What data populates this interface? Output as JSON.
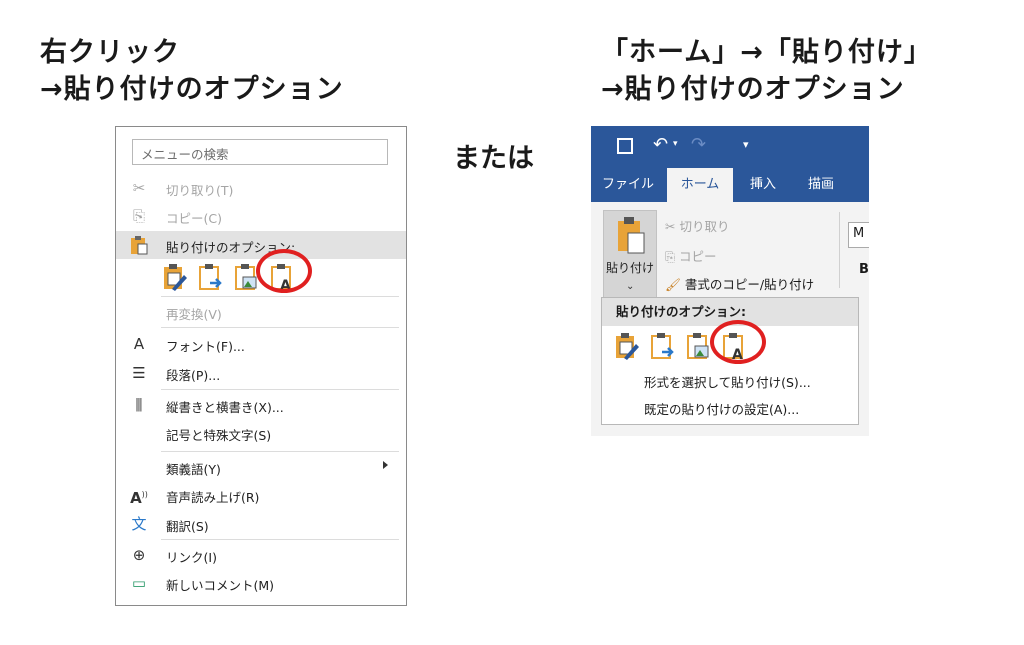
{
  "headings": {
    "left_line1": "右クリック",
    "left_line2": "→貼り付けのオプション",
    "right_line1": "「ホーム」→「貼り付け」",
    "right_line2": "→貼り付けのオプション",
    "or": "または"
  },
  "context_menu": {
    "search_placeholder": "メニューの検索",
    "cut": "切り取り(T)",
    "copy": "コピー(C)",
    "paste_options": "貼り付けのオプション:",
    "reconvert": "再変換(V)",
    "font": "フォント(F)...",
    "paragraph": "段落(P)...",
    "vertical_horizontal": "縦書きと横書き(X)...",
    "symbols": "記号と特殊文字(S)",
    "thesaurus": "類義語(Y)",
    "read_aloud": "音声読み上げ(R)",
    "translate": "翻訳(S)",
    "link": "リンク(I)",
    "new_comment": "新しいコメント(M)",
    "font_icon": "A",
    "read_icon": "A"
  },
  "ribbon": {
    "tabs": [
      "ファイル",
      "ホーム",
      "挿入",
      "描画"
    ],
    "active_tab": "ホーム",
    "paste_button": "貼り付け",
    "cut": "切り取り",
    "copy": "コピー",
    "format_painter": "書式のコピー/貼り付け",
    "font_box": "M",
    "bold": "B",
    "dropdown_header": "貼り付けのオプション:",
    "paste_special": "形式を選択して貼り付け(S)...",
    "default_paste": "既定の貼り付けの設定(A)..."
  },
  "colors": {
    "ribbon_blue": "#2b579a",
    "highlight_red": "#e02020"
  }
}
